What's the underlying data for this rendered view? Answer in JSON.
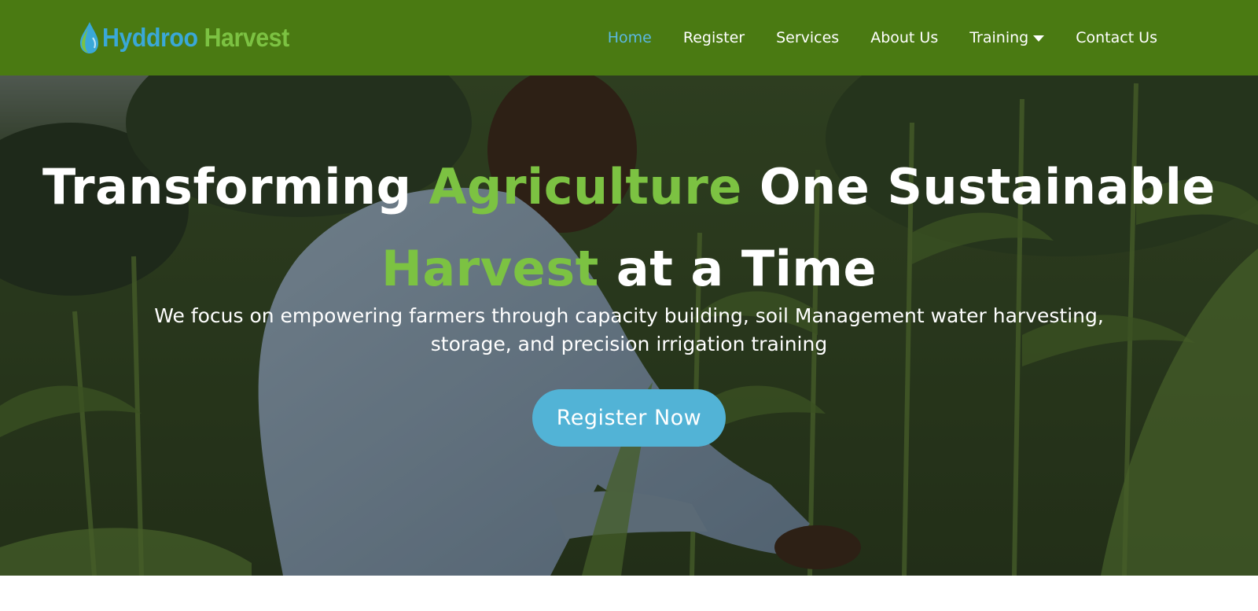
{
  "brand": {
    "name_part1": "Hyddroo",
    "name_part2": "Harvest",
    "logo_icon": "water-drop-icon",
    "color_blue": "#3aa8d8",
    "color_green": "#7cc242"
  },
  "nav": {
    "background": "#4a7a12",
    "items": [
      {
        "label": "Home",
        "active": true
      },
      {
        "label": "Register",
        "active": false
      },
      {
        "label": "Services",
        "active": false
      },
      {
        "label": "About Us",
        "active": false
      },
      {
        "label": "Training",
        "active": false,
        "dropdown": true
      },
      {
        "label": "Contact Us",
        "active": false
      }
    ],
    "active_color": "#5bb8e0",
    "dropdown_icon": "caret-down-icon"
  },
  "hero": {
    "title": {
      "w1": "Transforming",
      "w2": "Agriculture",
      "w3": "One Sustainable",
      "w4": "Harvest",
      "w5": "at a Time"
    },
    "highlight_color": "#7cc242",
    "subtitle": "We focus on empowering farmers through capacity building, soil Management water harvesting, storage, and precision irrigation training",
    "cta_label": "Register Now",
    "cta_color": "#52b3d6",
    "background_image": "farmer-in-maize-field-photo"
  }
}
